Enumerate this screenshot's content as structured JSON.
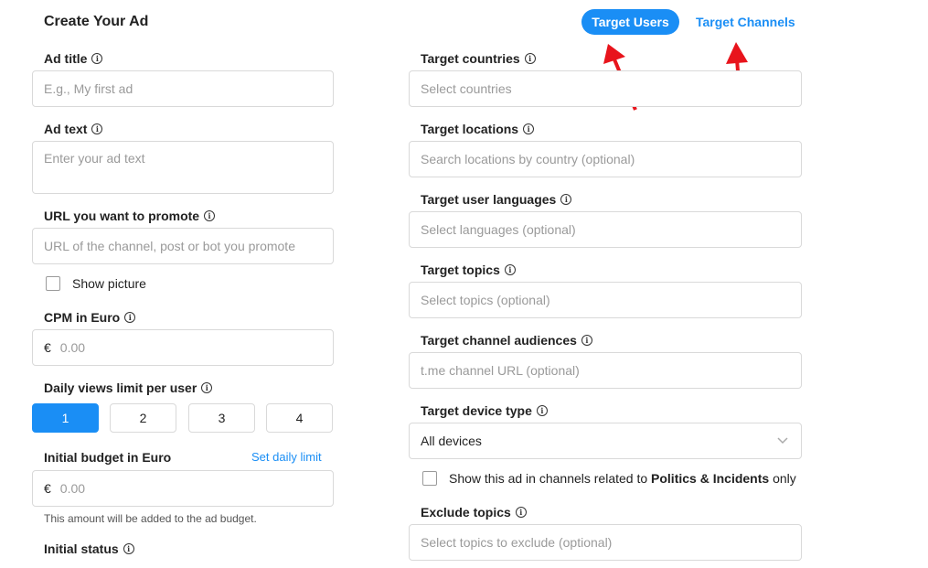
{
  "header": {
    "title": "Create Your Ad",
    "tab_users": "Target Users",
    "tab_channels": "Target Channels"
  },
  "left": {
    "ad_title_label": "Ad title",
    "ad_title_placeholder": "E.g., My first ad",
    "ad_text_label": "Ad text",
    "ad_text_placeholder": "Enter your ad text",
    "url_label": "URL you want to promote",
    "url_placeholder": "URL of the channel, post or bot you promote",
    "show_picture_label": "Show picture",
    "cpm_label": "CPM in Euro",
    "currency_symbol": "€",
    "cpm_placeholder": "0.00",
    "views_limit_label": "Daily views limit per user",
    "views_options": [
      "1",
      "2",
      "3",
      "4"
    ],
    "budget_label": "Initial budget in Euro",
    "set_daily_limit": "Set daily limit",
    "budget_placeholder": "0.00",
    "budget_hint": "This amount will be added to the ad budget.",
    "status_label": "Initial status"
  },
  "right": {
    "countries_label": "Target countries",
    "countries_placeholder": "Select countries",
    "locations_label": "Target locations",
    "locations_placeholder": "Search locations by country (optional)",
    "languages_label": "Target user languages",
    "languages_placeholder": "Select languages (optional)",
    "topics_label": "Target topics",
    "topics_placeholder": "Select topics (optional)",
    "audiences_label": "Target channel audiences",
    "audiences_placeholder": "t.me channel URL (optional)",
    "device_label": "Target device type",
    "device_value": "All devices",
    "politics_prefix": "Show this ad in channels related to",
    "politics_bold": "Politics & Incidents",
    "politics_suffix": "only",
    "exclude_label": "Exclude topics",
    "exclude_placeholder": "Select topics to exclude (optional)"
  },
  "colors": {
    "accent": "#1a8ef5",
    "annotation_arrow": "#e8141c"
  },
  "icons": {
    "info": "info-icon",
    "dropdown": "chevron-down-icon",
    "annotation": "red-arrow-icon"
  }
}
